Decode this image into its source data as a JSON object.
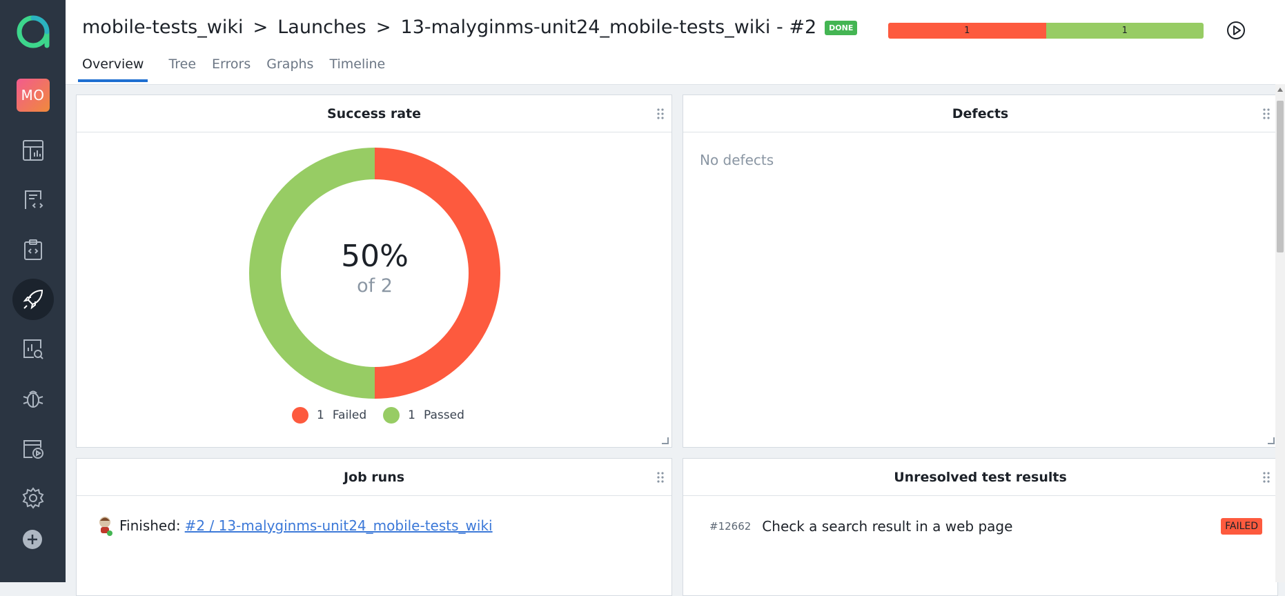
{
  "sidebar": {
    "avatar_initials": "MO",
    "items": [
      {
        "icon": "dashboard-icon"
      },
      {
        "icon": "test-cases-icon"
      },
      {
        "icon": "test-plans-icon"
      },
      {
        "icon": "launches-icon",
        "active": true
      },
      {
        "icon": "analytics-icon"
      },
      {
        "icon": "defects-icon"
      },
      {
        "icon": "jobs-icon"
      },
      {
        "icon": "settings-icon"
      }
    ],
    "add_icon": "plus-circle-icon"
  },
  "header": {
    "breadcrumb": [
      "mobile-tests_wiki",
      "Launches",
      "13-malyginms-unit24_mobile-tests_wiki - #2"
    ],
    "separator": ">",
    "status_badge": "DONE",
    "progress": {
      "failed": 1,
      "passed": 1,
      "failed_label": "1",
      "passed_label": "1"
    },
    "tabs": [
      "Overview",
      "Tree",
      "Errors",
      "Graphs",
      "Timeline"
    ],
    "active_tab": "Overview"
  },
  "widgets": {
    "success_rate": {
      "title": "Success rate",
      "percent_text": "50%",
      "of_text": "of 2",
      "legend": [
        {
          "count": "1",
          "label": "Failed",
          "color": "#fd5a3e"
        },
        {
          "count": "1",
          "label": "Passed",
          "color": "#97cc64"
        }
      ]
    },
    "defects": {
      "title": "Defects",
      "empty_text": "No defects"
    },
    "job_runs": {
      "title": "Job runs",
      "status_text": "Finished:",
      "link_text": "#2 / 13-malyginms-unit24_mobile-tests_wiki"
    },
    "unresolved": {
      "title": "Unresolved test results",
      "id": "#12662",
      "name": "Check a search result in a web page",
      "status": "FAILED"
    }
  },
  "chart_data": {
    "type": "pie",
    "categories": [
      "Failed",
      "Passed"
    ],
    "values": [
      1,
      1
    ],
    "colors": [
      "#fd5a3e",
      "#97cc64"
    ],
    "title": "Success rate"
  },
  "colors": {
    "sidebar_bg": "#2b3542",
    "accent": "#1f6fd1",
    "failed": "#fd5a3e",
    "passed": "#97cc64",
    "done": "#44b553"
  }
}
